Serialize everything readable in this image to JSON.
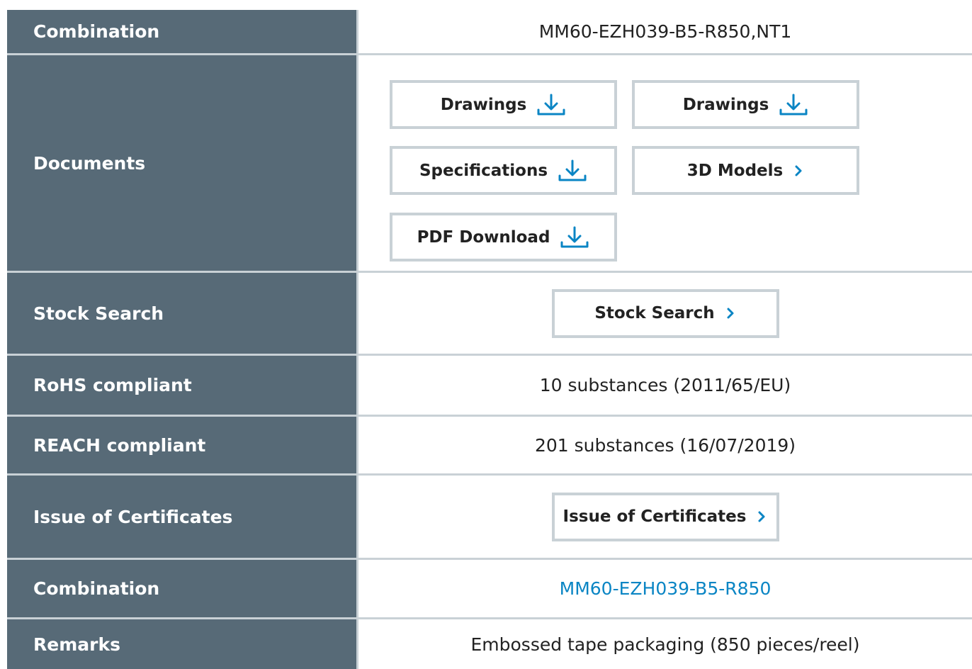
{
  "rows": {
    "combination_top": {
      "label": "Combination",
      "value": "MM60-EZH039-B5-R850,NT1"
    },
    "documents": {
      "label": "Documents",
      "buttons": [
        {
          "label": "Drawings",
          "icon": "download-icon"
        },
        {
          "label": "Drawings",
          "icon": "download-icon"
        },
        {
          "label": "Specifications",
          "icon": "download-icon"
        },
        {
          "label": "3D Models",
          "icon": "chevron-right-icon"
        },
        {
          "label": "PDF Download",
          "icon": "download-icon"
        }
      ]
    },
    "stock_search": {
      "label": "Stock Search",
      "button": "Stock Search",
      "icon": "chevron-right-icon"
    },
    "rohs": {
      "label": "RoHS compliant",
      "value": "10 substances (2011/65/EU)"
    },
    "reach": {
      "label": "REACH compliant",
      "value": "201 substances (16/07/2019)"
    },
    "certificates": {
      "label": "Issue of Certificates",
      "button": "Issue of Certificates",
      "icon": "chevron-right-icon"
    },
    "combination_link": {
      "label": "Combination",
      "value": "MM60-EZH039-B5-R850"
    },
    "remarks": {
      "label": "Remarks",
      "value": "Embossed tape packaging (850 pieces/reel)"
    }
  },
  "colors": {
    "label_bg": "#576a77",
    "border": "#c9d1d6",
    "accent": "#0a85c4"
  }
}
